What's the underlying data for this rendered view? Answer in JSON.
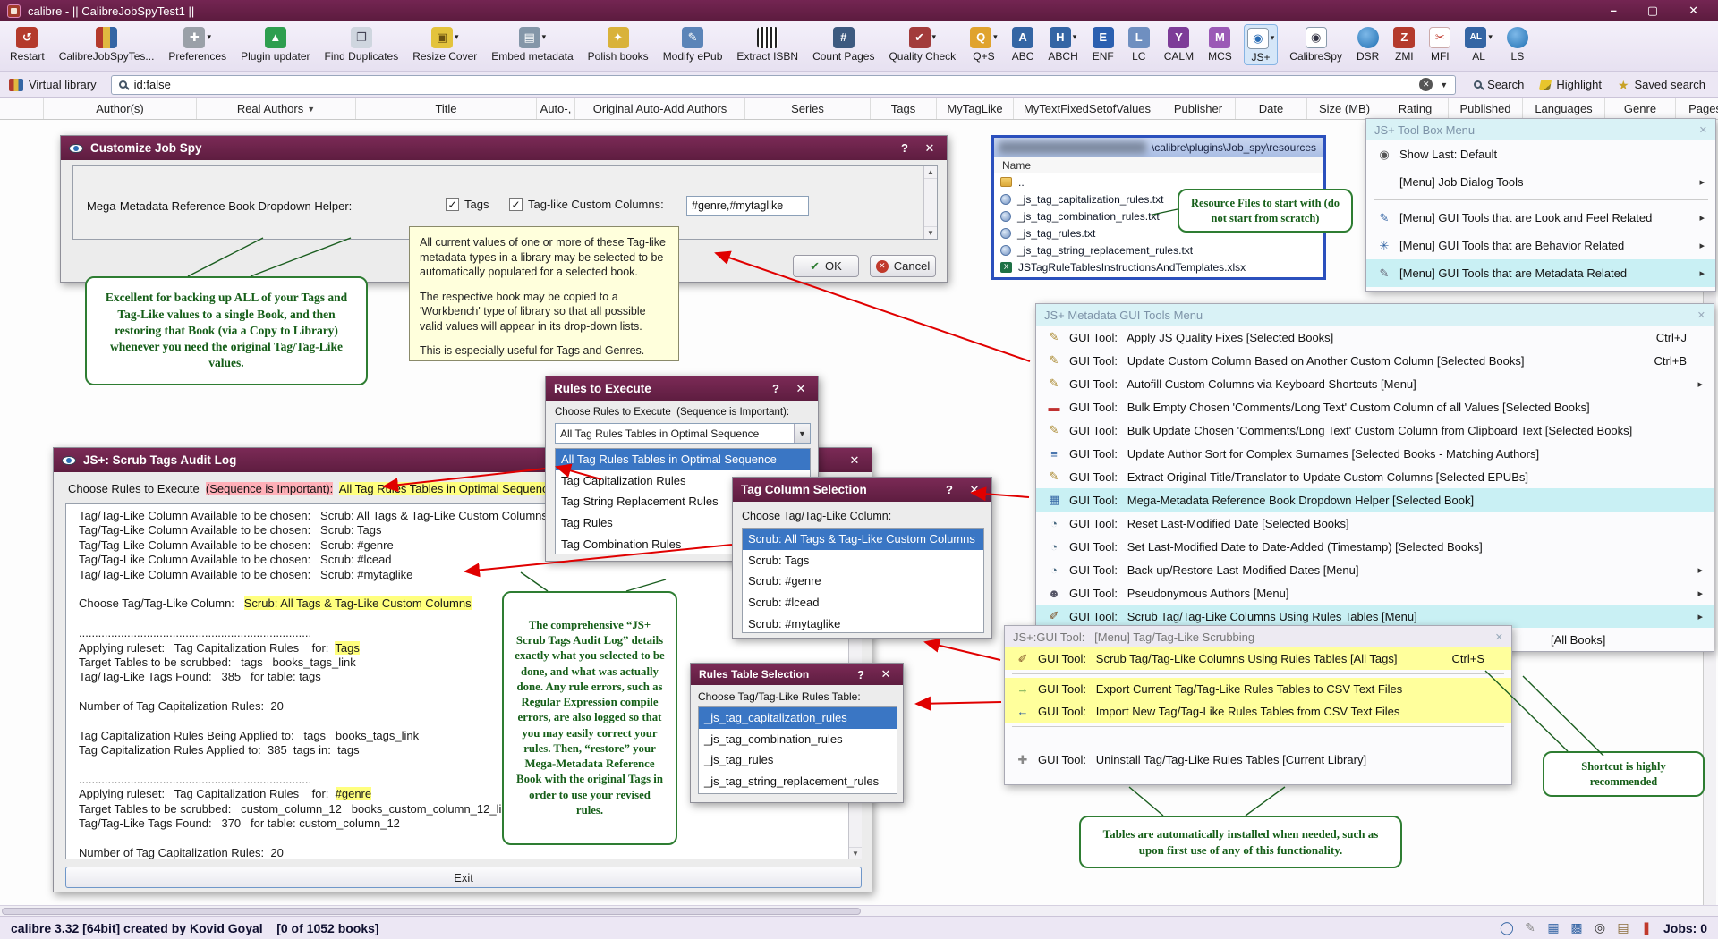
{
  "titlebar": {
    "title": "calibre - || CalibreJobSpyTest1 ||",
    "minimize": "–",
    "maximize": "▢",
    "close": "✕"
  },
  "toolbar": {
    "items": [
      {
        "label": "Restart",
        "icon": "restart",
        "dropdown": false
      },
      {
        "label": "CalibreJobSpyTes...",
        "icon": "library",
        "dropdown": false
      },
      {
        "label": "Preferences",
        "icon": "preferences",
        "dropdown": true
      },
      {
        "label": "Plugin updater",
        "icon": "plugin-updater",
        "dropdown": false
      },
      {
        "label": "Find Duplicates",
        "icon": "find-duplicates",
        "dropdown": false
      },
      {
        "label": "Resize Cover",
        "icon": "resize-cover",
        "dropdown": true
      },
      {
        "label": "Embed metadata",
        "icon": "embed-metadata",
        "dropdown": true
      },
      {
        "label": "Polish books",
        "icon": "polish-books",
        "dropdown": false
      },
      {
        "label": "Modify ePub",
        "icon": "modify-epub",
        "dropdown": false
      },
      {
        "label": "Extract ISBN",
        "icon": "extract-isbn",
        "dropdown": false
      },
      {
        "label": "Count Pages",
        "icon": "count-pages",
        "dropdown": false
      },
      {
        "label": "Quality Check",
        "icon": "quality-check",
        "dropdown": true
      },
      {
        "label": "Q+S",
        "icon": "qs",
        "dropdown": true
      },
      {
        "label": "ABC",
        "icon": "abc",
        "dropdown": false
      },
      {
        "label": "ABCH",
        "icon": "abch",
        "dropdown": true
      },
      {
        "label": "ENF",
        "icon": "enf",
        "dropdown": false
      },
      {
        "label": "LC",
        "icon": "lc",
        "dropdown": false
      },
      {
        "label": "CALM",
        "icon": "calm",
        "dropdown": false
      },
      {
        "label": "MCS",
        "icon": "mcs",
        "dropdown": false
      },
      {
        "label": "JS+",
        "icon": "jsplus-eye",
        "dropdown": true,
        "active": true
      },
      {
        "label": "CalibreSpy",
        "icon": "spy-eye",
        "dropdown": false
      },
      {
        "label": "DSR",
        "icon": "dsr-drop",
        "dropdown": false
      },
      {
        "label": "ZMI",
        "icon": "zmi",
        "dropdown": false
      },
      {
        "label": "MFI",
        "icon": "mfi-scissors",
        "dropdown": false
      },
      {
        "label": "AL",
        "icon": "al",
        "dropdown": true
      },
      {
        "label": "LS",
        "icon": "ls-drop",
        "dropdown": false
      }
    ]
  },
  "searchbar": {
    "virtual_library": "Virtual library",
    "search_value": "id:false",
    "search_button": "Search",
    "highlight_button": "Highlight",
    "saved_search": "Saved search"
  },
  "columns": [
    "",
    "Author(s)",
    "Real Authors",
    "Title",
    "Auto-,",
    "Original Auto-Add Authors",
    "Series",
    "Tags",
    "MyTagLike",
    "MyTextFixedSetofValues",
    "Publisher",
    "Date",
    "Size (MB)",
    "Rating",
    "Published",
    "Languages",
    "Genre",
    "Pages"
  ],
  "customize": {
    "title": "Customize Job Spy",
    "help": "?",
    "close": "✕",
    "label": "Mega-Metadata Reference Book Dropdown Helper:",
    "check1": "Tags",
    "check2": "Tag-like Custom Columns:",
    "field_value": "#genre,#mytaglike",
    "ok": "OK",
    "cancel": "Cancel"
  },
  "tooltip": {
    "p1": "All current values of one or more of these Tag-like metadata types in a library may be selected to be automatically populated for a selected book.",
    "p2": "The respective book may be copied to a 'Workbench' type of library so that all possible valid values will appear in its drop-down lists.",
    "p3": "This is especially useful for Tags and Genres."
  },
  "callouts": {
    "backup": "Excellent for backing up ALL of your Tags and Tag-Like values to a single Book, and then restoring that Book (via a Copy to Library) whenever you need the original Tag/Tag-Like values.",
    "resources": "Resource Files to start with (do not start from scratch)",
    "audit": "The comprehensive “JS+ Scrub Tags Audit Log” details exactly what you selected to be done, and what was actually done.  Any rule errors, such as Regular Expression compile errors, are also logged so that you may easily correct your rules.  Then, “restore” your Mega-Metadata Reference Book with the original Tags in order to use your revised rules.",
    "tables": "Tables are automatically installed when needed, such as upon first use of any of this functionality.",
    "shortcut": "Shortcut is highly recommended"
  },
  "file_browser": {
    "path": "\\calibre\\plugins\\Job_spy\\resources",
    "header": "Name",
    "rows": [
      {
        "icon": "folder-icon",
        "name": ".."
      },
      {
        "icon": "globe-file-icon",
        "name": "_js_tag_capitalization_rules.txt"
      },
      {
        "icon": "globe-file-icon",
        "name": "_js_tag_combination_rules.txt"
      },
      {
        "icon": "globe-file-icon",
        "name": "_js_tag_rules.txt"
      },
      {
        "icon": "globe-file-icon",
        "name": "_js_tag_string_replacement_rules.txt"
      },
      {
        "icon": "excel-file-icon",
        "name": "JSTagRuleTablesInstructionsAndTemplates.xlsx"
      }
    ]
  },
  "toolbox_menu": {
    "title": "JS+ Tool Box Menu",
    "items": [
      {
        "icon": "radio",
        "label": "Show Last: Default"
      },
      {
        "icon": "blank",
        "label": "[Menu] Job Dialog Tools",
        "submenu": true
      },
      {
        "sep": true
      },
      {
        "icon": "pen-blue",
        "label": "[Menu] GUI Tools that are Look and Feel Related",
        "submenu": true
      },
      {
        "icon": "gear",
        "label": "[Menu] GUI Tools that are Behavior Related",
        "submenu": true
      },
      {
        "icon": "pen-gray",
        "label": "[Menu] GUI Tools that are Metadata Related",
        "submenu": true,
        "highlight": true
      }
    ]
  },
  "metadata_menu": {
    "title": "JS+ Metadata GUI Tools Menu",
    "items": [
      {
        "icon": "pencil",
        "label": "GUI Tool:   Apply JS Quality Fixes [Selected Books]",
        "shortcut": "Ctrl+J"
      },
      {
        "icon": "pencil",
        "label": "GUI Tool:   Update Custom Column Based on Another Custom Column [Selected Books]",
        "shortcut": "Ctrl+B"
      },
      {
        "icon": "pencil",
        "label": "GUI Tool:   Autofill Custom Columns via Keyboard Shortcuts [Menu]",
        "submenu": true
      },
      {
        "icon": "minus",
        "label": "GUI Tool:   Bulk Empty Chosen 'Comments/Long Text' Custom Column of all Values [Selected Books]"
      },
      {
        "icon": "pencil",
        "label": "GUI Tool:   Bulk Update Chosen 'Comments/Long Text' Custom Column from Clipboard Text [Selected Books]"
      },
      {
        "icon": "sort",
        "label": "GUI Tool:   Update Author Sort for Complex Surnames [Selected Books - Matching Authors]"
      },
      {
        "icon": "pencil",
        "label": "GUI Tool:   Extract Original Title/Translator to Update Custom Columns [Selected EPUBs]"
      },
      {
        "icon": "grid",
        "label": "GUI Tool:   Mega-Metadata Reference Book Dropdown Helper [Selected Book]",
        "highlight": true
      },
      {
        "icon": "clock",
        "label": "GUI Tool:   Reset Last-Modified Date [Selected Books]"
      },
      {
        "icon": "clock",
        "label": "GUI Tool:   Set Last-Modified Date to Date-Added (Timestamp) [Selected Books]"
      },
      {
        "icon": "clock",
        "label": "GUI Tool:   Back up/Restore Last-Modified Dates [Menu]",
        "submenu": true
      },
      {
        "icon": "person",
        "label": "GUI Tool:   Pseudonymous Authors [Menu]",
        "submenu": true
      },
      {
        "icon": "broom",
        "label": "GUI Tool:   Scrub Tag/Tag-Like Columns Using Rules Tables [Menu]",
        "submenu": true,
        "highlight": true
      },
      {
        "icon": "blank",
        "label": "[All Books]",
        "partial": true
      }
    ]
  },
  "scrub_menu": {
    "title": "JS+:GUI Tool:   [Menu] Tag/Tag-Like Scrubbing",
    "items": [
      {
        "icon": "broom",
        "label": "GUI Tool:   Scrub Tag/Tag-Like Columns Using Rules Tables [All Tags]",
        "shortcut": "Ctrl+S",
        "yellow": true
      },
      {
        "sep": true
      },
      {
        "icon": "export",
        "label": "GUI Tool:   Export Current Tag/Tag-Like Rules Tables to CSV Text Files",
        "yellow": true
      },
      {
        "icon": "import",
        "label": "GUI Tool:   Import New Tag/Tag-Like Rules Tables from CSV Text Files",
        "yellow": true
      },
      {
        "sep": true
      },
      {
        "icon": "tool",
        "label": "GUI Tool:   Uninstall Tag/Tag-Like Rules Tables [Current Library]",
        "gap": true
      }
    ]
  },
  "rules_dialog": {
    "title": "Rules to Execute",
    "help": "?",
    "close": "✕",
    "label": "Choose Rules to Execute  (Sequence is Important):",
    "combo": "All Tag Rules Tables in Optimal Sequence",
    "items": [
      {
        "label": "All Tag Rules Tables in Optimal Sequence",
        "selected": true
      },
      {
        "label": "Tag Capitalization Rules"
      },
      {
        "label": "Tag String Replacement Rules"
      },
      {
        "label": "Tag Rules"
      },
      {
        "label": "Tag Combination Rules"
      }
    ]
  },
  "tag_column_dialog": {
    "title": "Tag Column Selection",
    "help": "?",
    "close": "✕",
    "label": "Choose Tag/Tag-Like Column:",
    "items": [
      {
        "label": "Scrub: All Tags & Tag-Like Custom Columns",
        "selected": true
      },
      {
        "label": "Scrub: Tags"
      },
      {
        "label": "Scrub: #genre"
      },
      {
        "label": "Scrub: #lcead"
      },
      {
        "label": "Scrub: #mytaglike"
      }
    ]
  },
  "rules_table_dialog": {
    "title": "Rules Table Selection",
    "help": "?",
    "close": "✕",
    "label": "Choose Tag/Tag-Like Rules Table:",
    "items": [
      {
        "label": "_js_tag_capitalization_rules",
        "selected": true
      },
      {
        "label": "_js_tag_combination_rules"
      },
      {
        "label": "_js_tag_rules"
      },
      {
        "label": "_js_tag_string_replacement_rules"
      }
    ]
  },
  "audit_dialog": {
    "title": "JS+:  Scrub Tags Audit Log",
    "close": "✕",
    "exit": "Exit",
    "band": [
      {
        "t": "Choose Rules to Execute  "
      },
      {
        "t": "(Sequence is Important):",
        "hl": "p"
      },
      {
        "t": "  "
      },
      {
        "t": "All Tag Rules Tables in Optimal Sequence",
        "hl": "y"
      }
    ],
    "lines": [
      [
        {
          "t": "Tag/Tag-Like Column Available to be chosen:   Scrub: All Tags & Tag-Like Custom Columns"
        }
      ],
      [
        {
          "t": "Tag/Tag-Like Column Available to be chosen:   Scrub: Tags"
        }
      ],
      [
        {
          "t": "Tag/Tag-Like Column Available to be chosen:   Scrub: #genre"
        }
      ],
      [
        {
          "t": "Tag/Tag-Like Column Available to be chosen:   Scrub: #lcead"
        }
      ],
      [
        {
          "t": "Tag/Tag-Like Column Available to be chosen:   Scrub: #mytaglike"
        }
      ],
      [
        {
          "t": ""
        }
      ],
      [
        {
          "t": "Choose Tag/Tag-Like Column:   "
        },
        {
          "t": "Scrub: All Tags & Tag-Like Custom Columns",
          "hl": "y"
        }
      ],
      [
        {
          "t": ""
        }
      ],
      [
        {
          "t": "........................................................................"
        }
      ],
      [
        {
          "t": "Applying ruleset:   Tag Capitalization Rules    for:  "
        },
        {
          "t": "Tags",
          "hl": "y"
        }
      ],
      [
        {
          "t": "Target Tables to be scrubbed:   tags   books_tags_link"
        }
      ],
      [
        {
          "t": "Tag/Tag-Like Tags Found:   385   for table: tags"
        }
      ],
      [
        {
          "t": ""
        }
      ],
      [
        {
          "t": "Number of Tag Capitalization Rules:  20"
        }
      ],
      [
        {
          "t": ""
        }
      ],
      [
        {
          "t": "Tag Capitalization Rules Being Applied to:   tags   books_tags_link"
        }
      ],
      [
        {
          "t": "Tag Capitalization Rules Applied to:  385  tags in:  tags"
        }
      ],
      [
        {
          "t": ""
        }
      ],
      [
        {
          "t": "........................................................................"
        }
      ],
      [
        {
          "t": "Applying ruleset:   Tag Capitalization Rules    for:  "
        },
        {
          "t": "#genre",
          "hl": "y"
        }
      ],
      [
        {
          "t": "Target Tables to be scrubbed:   custom_column_12   books_custom_column_12_link"
        }
      ],
      [
        {
          "t": "Tag/Tag-Like Tags Found:   370   for table: custom_column_12"
        }
      ],
      [
        {
          "t": ""
        }
      ],
      [
        {
          "t": "Number of Tag Capitalization Rules:  20"
        }
      ]
    ]
  },
  "statusbar": {
    "left": "calibre 3.32 [64bit] created by Kovid Goyal    [0 of 1052 books]",
    "jobs": "Jobs: 0",
    "icons": [
      {
        "name": "search-icon",
        "g": "◯",
        "c": "#3465a4"
      },
      {
        "name": "edit-icon",
        "g": "✎",
        "c": "#888"
      },
      {
        "name": "grid-small-icon",
        "g": "▦",
        "c": "#3465a4"
      },
      {
        "name": "grid-large-icon",
        "g": "▩",
        "c": "#3465a4"
      },
      {
        "name": "cover-grid-icon",
        "g": "◎",
        "c": "#333"
      },
      {
        "name": "book-details-icon",
        "g": "▤",
        "c": "#8a6d3b"
      },
      {
        "name": "bookmark-icon",
        "g": "❚",
        "c": "#c0392b"
      }
    ]
  },
  "colors": {
    "accent_maroon": "#5e1d40",
    "highlight_cyan": "#c9f0f4",
    "highlight_yellow": "#ffff9c",
    "selection_blue": "#3a76c4",
    "callout_green": "#2e7d32",
    "arrow_red": "#e00000"
  }
}
